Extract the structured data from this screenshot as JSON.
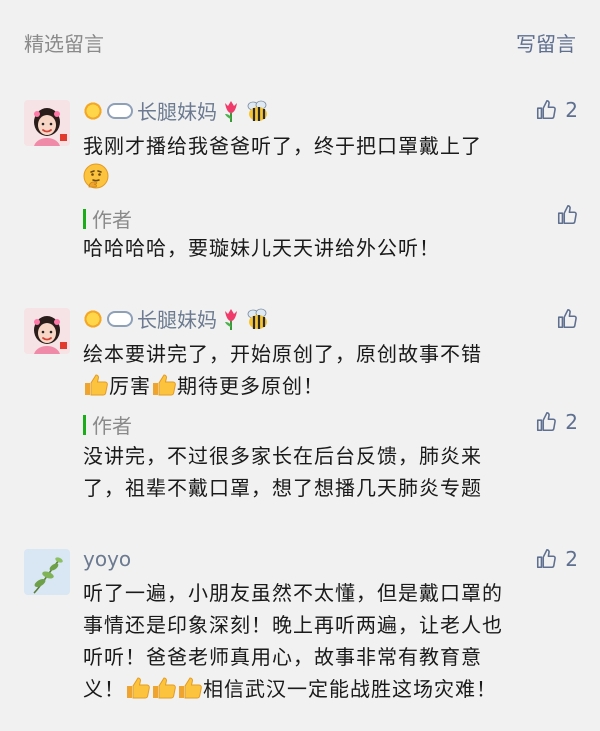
{
  "header": {
    "title": "精选留言",
    "write_label": "写留言"
  },
  "comments": [
    {
      "name": "长腿妹妈",
      "avatar_icon": "girl-avatar",
      "likes": "2",
      "text_line1": "我刚才播给我爸爸听了，终于把口罩戴上了",
      "reply": {
        "label": "作者",
        "text": "哈哈哈哈，要璇妹儿天天讲给外公听！",
        "likes": ""
      }
    },
    {
      "name": "长腿妹妈",
      "avatar_icon": "girl-avatar",
      "likes": "",
      "text_line1": "绘本要讲完了，开始原创了，原创故事不错",
      "text_line2_part1": "厉害",
      "text_line2_part2": "期待更多原创！",
      "reply": {
        "label": "作者",
        "text_line1": "没讲完，不过很多家长在后台反馈，肺炎来",
        "text_line2": "了，祖辈不戴口罩，想了想播几天肺炎专题",
        "likes": "2"
      }
    },
    {
      "name": "yoyo",
      "avatar_icon": "plant-avatar",
      "likes": "2",
      "text_line1": "听了一遍，小朋友虽然不太懂，但是戴口罩的",
      "text_line2": "事情还是印象深刻！晚上再听两遍，让老人也",
      "text_line3": "听听！爸爸老师真用心，故事非常有教育意",
      "text_line4_prefix": "义！",
      "text_line4_suffix": "相信武汉一定能战胜这场灾难！"
    }
  ],
  "colors": {
    "name": "#6b7a90",
    "link": "#5e6f8f",
    "reply_bar": "#1aad19",
    "background": "#f1f1f1"
  }
}
